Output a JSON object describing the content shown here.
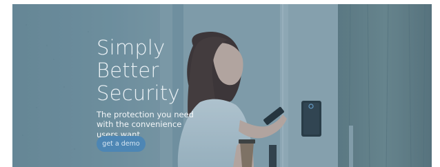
{
  "hero": {
    "headline": [
      "Simply",
      "Better",
      "Security"
    ],
    "tagline": [
      "The protection you need",
      "with the convenience",
      "users want"
    ],
    "cta_label": "get a demo"
  },
  "colors": {
    "overlay": "#5f7f8e",
    "button": "#4d86b4",
    "text": "#eaf1f5"
  },
  "icons": {
    "phone": "smartphone",
    "reader": "access-control-reader",
    "cup": "coffee-cup"
  }
}
